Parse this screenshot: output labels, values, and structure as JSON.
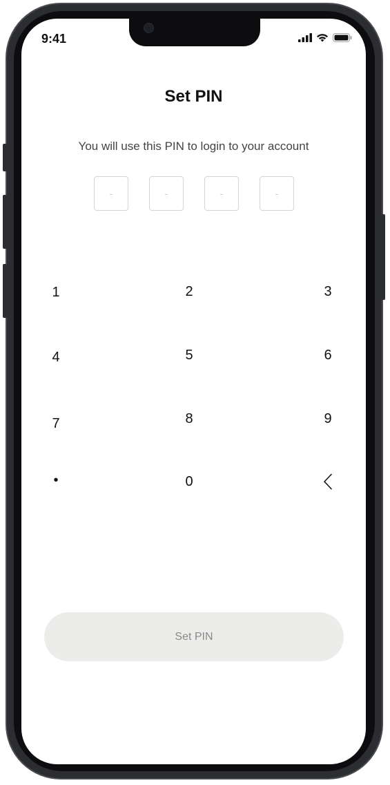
{
  "status_bar": {
    "time": "9:41"
  },
  "screen": {
    "title": "Set PIN",
    "subtitle": "You will use this PIN to login to your account",
    "pin_placeholders": [
      "-",
      "-",
      "-",
      "-"
    ]
  },
  "keypad": {
    "keys": [
      "1",
      "2",
      "3",
      "4",
      "5",
      "6",
      "7",
      "8",
      "9",
      "•",
      "0"
    ],
    "backspace_icon": "chevron-left-icon"
  },
  "actions": {
    "submit_label": "Set PIN"
  },
  "colors": {
    "button_disabled_bg": "#ecedea",
    "button_disabled_text": "#8a8a8a",
    "pin_box_border": "#d4d4d4"
  }
}
